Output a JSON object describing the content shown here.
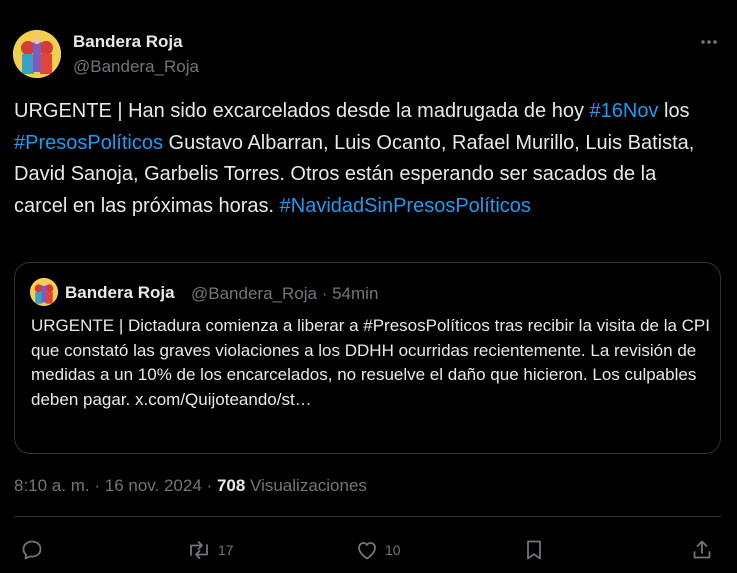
{
  "author": {
    "name": "Bandera Roja",
    "handle": "@Bandera_Roja"
  },
  "tweet": {
    "segments": [
      {
        "text": "URGENTE | Han sido excarcelados desde la madrugada de hoy ",
        "link": false
      },
      {
        "text": "#16Nov",
        "link": true
      },
      {
        "text": " los ",
        "link": false
      },
      {
        "text": "#PresosPolíticos",
        "link": true
      },
      {
        "text": " Gustavo Albarran, Luis Ocanto, Rafael Murillo, Luis Batista, David Sanoja, Garbelis Torres. Otros están esperando ser sacados de la carcel en las próximas horas. ",
        "link": false
      },
      {
        "text": "#NavidadSinPresosPolíticos",
        "link": true
      }
    ]
  },
  "quote": {
    "name": "Bandera Roja",
    "handle": "@Bandera_Roja",
    "separator": "·",
    "time": "54min",
    "text": "URGENTE | Dictadura comienza a liberar a #PresosPolíticos tras recibir la visita de la CPI que constató las graves violaciones a los DDHH ocurridas recientemente. La revisión de medidas a un 10% de los encarcelados, no resuelve el daño que hicieron. Los culpables deben pagar. x.com/Quijoteando/st…"
  },
  "meta": {
    "time": "8:10 a. m.",
    "separator": "·",
    "date": "16 nov. 2024",
    "views_count": "708",
    "views_label": "Visualizaciones"
  },
  "actions": {
    "reply_count": "",
    "retweet_count": "17",
    "like_count": "10",
    "icons": [
      "reply-icon",
      "retweet-icon",
      "like-icon",
      "bookmark-icon",
      "share-icon"
    ]
  },
  "colors": {
    "background": "#000000",
    "text": "#e7e9ea",
    "muted": "#71767b",
    "link": "#1d9bf0",
    "border": "#2f3336"
  }
}
